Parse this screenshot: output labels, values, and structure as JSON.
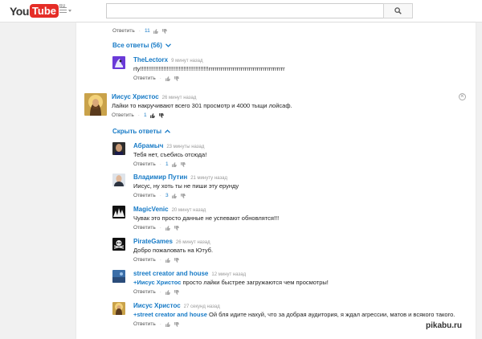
{
  "header": {
    "logo_you": "You",
    "logo_tube": "Tube",
    "logo_region": "RU",
    "search_value": ""
  },
  "top_comment_partial": {
    "reply": "Ответить",
    "likes": "11"
  },
  "all_replies_link": "Все ответы (56)",
  "lectorx": {
    "author": "TheLectorx",
    "time": "9 минут назад",
    "text": "rty!!!!!!!!!!!!!!!!!!!!!!!!!!!!!!!!!!!!!!!!!rrrrrrrrrrrrrrrrrrrrrrrrrrrrrrrrrrrrrr",
    "reply": "Ответить"
  },
  "main_comment": {
    "author": "Иисус Христос",
    "time": "26 минут назад",
    "text": "Лайки то накручивают всего 301 просмотр и 4000 тыщи лойсаф.",
    "reply": "Ответить",
    "likes": "1"
  },
  "hide_replies_link": "Скрыть ответы",
  "replies": [
    {
      "author": "Абрамыч",
      "time": "23 минуты назад",
      "text": "Тебя нет, съебись отсюда!",
      "mention": "",
      "reply": "Ответить",
      "likes": "1"
    },
    {
      "author": "Владимир Путин",
      "time": "21 минуту назад",
      "text": "Иисус, ну хоть ты не пиши эту ерунду",
      "mention": "",
      "reply": "Ответить",
      "likes": "3"
    },
    {
      "author": "MagicVenic",
      "time": "20 минут назад",
      "text": "Чувак это просто данные не успевают обновлятся!!!",
      "mention": "",
      "reply": "Ответить",
      "likes": ""
    },
    {
      "author": "PirateGames",
      "time": "26 минут назад",
      "text": "Добро пожаловать на Ютуб.",
      "mention": "",
      "reply": "Ответить",
      "likes": ""
    },
    {
      "author": "street creator and house",
      "time": "12 минут назад",
      "text": " просто лайки быстрее загружаются чем просмотры!",
      "mention": "+Иисус Христос",
      "reply": "Ответить",
      "likes": ""
    },
    {
      "author": "Иисус Христос",
      "time": "27 секунд назад",
      "text": " Ой бля идите нахуй, что за добрая аудитория, я ждал агрессии, матов и всякого такого.",
      "mention": "+street creator and house",
      "reply": "Ответить",
      "likes": ""
    }
  ],
  "watermark": "pikabu.ru",
  "colors": {
    "link": "#167ac6",
    "brand_red": "#e52d27"
  }
}
